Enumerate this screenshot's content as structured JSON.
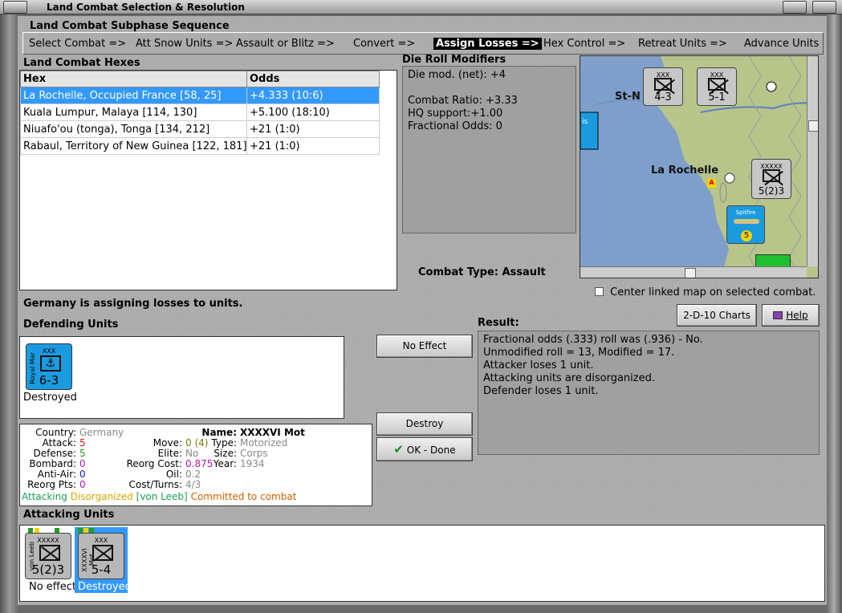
{
  "window": {
    "title": "Land Combat Selection & Resolution"
  },
  "sequence": {
    "title": "Land Combat Subphase Sequence",
    "steps": [
      "Select Combat =>",
      "Att Snow Units =>",
      "Assault or Blitz =>",
      "Convert =>",
      "Assign Losses =>",
      "Hex Control =>",
      "Retreat Units =>",
      "Advance Units"
    ],
    "active_index": 4
  },
  "hexes": {
    "title": "Land Combat Hexes",
    "headers": [
      "Hex",
      "Odds"
    ],
    "rows": [
      {
        "hex": "La Rochelle, Occupied France [58, 25]",
        "odds": "+4.333 (10:6)"
      },
      {
        "hex": "Kuala Lumpur, Malaya [114, 130]",
        "odds": "+5.100 (18:10)"
      },
      {
        "hex": "Niuafo'ou (tonga), Tonga [134, 212]",
        "odds": "+21 (1:0)"
      },
      {
        "hex": "Rabaul, Territory of New Guinea [122, 181]",
        "odds": "+21 (1:0)"
      }
    ]
  },
  "modifiers": {
    "title": "Die Roll Modifiers",
    "lines": [
      "Die mod. (net): +4",
      "",
      "Combat Ratio: +3.33",
      "HQ support:+1.00",
      "Fractional Odds: 0"
    ]
  },
  "map": {
    "place_label": "La Rochelle",
    "place_label2": "St-N",
    "markers": [
      "A",
      "5"
    ]
  },
  "combat_type": {
    "label": "Combat Type:",
    "value": "Assault"
  },
  "center_map": {
    "label": "Center linked map on selected combat.",
    "checked": false
  },
  "status": "Germany is assigning losses to units.",
  "buttons": {
    "charts": "2-D-10 Charts",
    "help": "Help",
    "no_effect": "No Effect",
    "destroy": "Destroy",
    "ok": "OK - Done"
  },
  "defending": {
    "title": "Defending Units",
    "units": [
      {
        "size": "XXX",
        "name": "Royal Mar",
        "values": "6-3",
        "status": "Destroyed",
        "color": "#1a9be0"
      }
    ]
  },
  "result": {
    "title": "Result:",
    "lines": [
      "Fractional odds (.333) roll was (.936)  - No.",
      "Unmodified roll = 13, Modified = 17.",
      "Attacker loses 1 unit.",
      "Attacking units are disorganized.",
      "Defender loses 1 unit."
    ]
  },
  "unit_info": {
    "country_label": "Country:",
    "country": "Germany",
    "attack_label": "Attack:",
    "attack": "5",
    "defense_label": "Defense:",
    "defense": "5",
    "bombard_label": "Bombard:",
    "bombard": "0",
    "antiair_label": "Anti-Air:",
    "antiair": "0",
    "reorg_label": "Reorg Pts:",
    "reorg": "0",
    "name_label": "Name:",
    "name": "XXXXVI Mot",
    "move_label": "Move:",
    "move": "0 (4)",
    "elite_label": "Elite:",
    "elite": "No",
    "reorg_cost_label": "Reorg Cost:",
    "reorg_cost": "0.875",
    "oil_label": "Oil:",
    "oil": "0.2",
    "cost_label": "Cost/Turns:",
    "cost": "4/3",
    "type_label": "Type:",
    "type": "Motorized",
    "size_label": "Size:",
    "size": "Corps",
    "year_label": "Year:",
    "year": "1934",
    "flags": [
      "Attacking",
      "Disorganized",
      "[von Leeb]",
      "Committed to combat"
    ]
  },
  "attacking": {
    "title": "Attacking Units",
    "units": [
      {
        "size": "XXXXX",
        "name": "von Leeb",
        "values": "5(2)3",
        "status": "No effect",
        "color": "#b8b8b8"
      },
      {
        "size": "XXX",
        "name": "XXXXVI Mot",
        "values": "5-4",
        "status": "Destroyed",
        "color": "#b8b8b8"
      }
    ]
  },
  "map_counters": [
    {
      "size": "XXX",
      "name": "II Korea",
      "values": "4-3"
    },
    {
      "size": "XXX",
      "name": "XXXIV Luft",
      "values": "5-1"
    },
    {
      "size": "XXXXX",
      "name": "von Leeb",
      "values": "5(2)3"
    },
    {
      "name": "Spitfire",
      "values": "5"
    }
  ]
}
